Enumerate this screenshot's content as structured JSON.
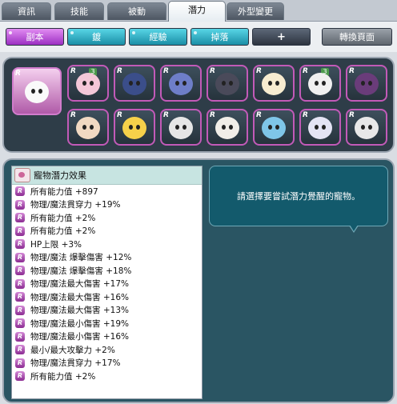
{
  "tabs": [
    {
      "label": "資訊",
      "active": false
    },
    {
      "label": "技能",
      "active": false
    },
    {
      "label": "被動",
      "active": false
    },
    {
      "label": "潛力",
      "active": true
    },
    {
      "label": "外型變更",
      "active": false
    }
  ],
  "toolbar": {
    "dungeon_label": "副本",
    "enhance_label": "鍍",
    "exp_label": "經驗",
    "drop_label": "掉落",
    "plus_label": "+",
    "switch_page_label": "轉換頁面"
  },
  "pets": {
    "rarity_mark": "R",
    "badge_value": "3",
    "colors": [
      "#f2f2f2",
      "#f4c7d8",
      "#3b4e8a",
      "#6e7ec8",
      "#2a2a3a",
      "#f7ecd0",
      "#f0f0f0",
      "#6a3c7a",
      "#f1d9c2",
      "#f6d14a",
      "#3a3a3a",
      "#f1eee8",
      "#7fc6e8",
      "#e4e4f4",
      "#e8e8e8"
    ]
  },
  "effects": {
    "title": "寵物潛力效果",
    "items": [
      "所有能力值 +897",
      "物理/魔法貫穿力 +19%",
      "所有能力值 +2%",
      "所有能力值 +2%",
      "HP上限 +3%",
      "物理/魔法 爆擊傷害 +12%",
      "物理/魔法 爆擊傷害 +18%",
      "物理/魔法最大傷害 +17%",
      "物理/魔法最大傷害 +16%",
      "物理/魔法最大傷害 +13%",
      "物理/魔法最小傷害 +19%",
      "物理/魔法最小傷害 +16%",
      "最小/最大攻擊力 +2%",
      "物理/魔法貫穿力 +17%",
      "所有能力值 +2%"
    ]
  },
  "hint": {
    "text": "請選擇要嘗試潛力覺醒的寵物。"
  }
}
